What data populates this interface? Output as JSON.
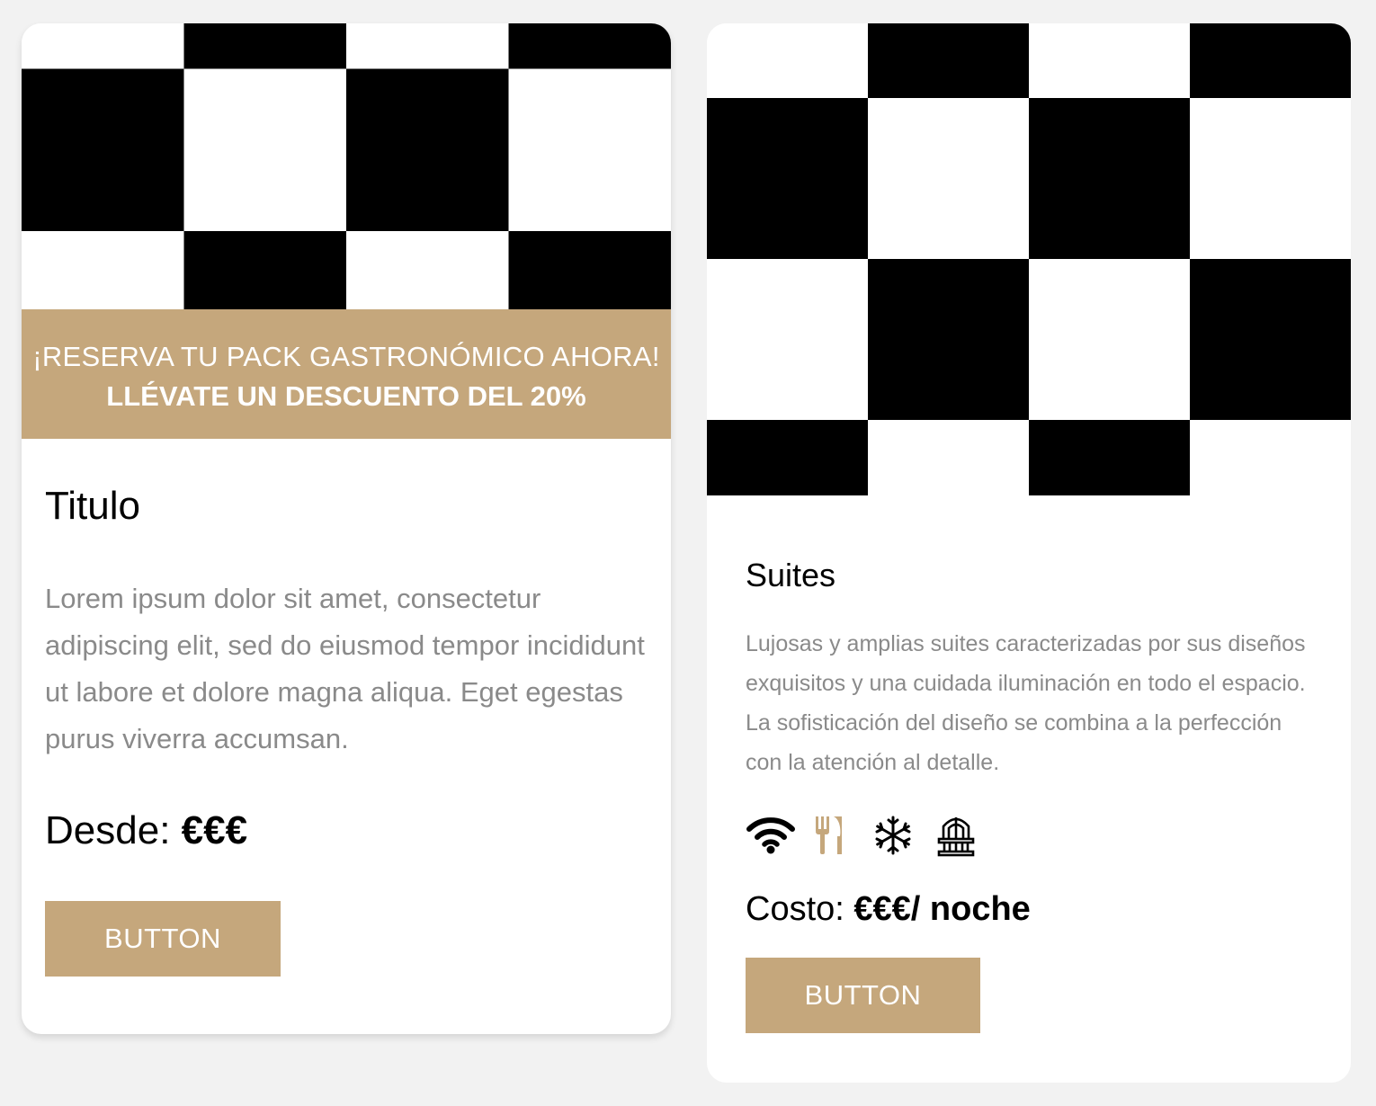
{
  "cards": [
    {
      "banner": {
        "line1": "¡RESERVA TU PACK GASTRONÓMICO AHORA!",
        "line2": "LLÉVATE UN DESCUENTO DEL 20%"
      },
      "title": "Titulo",
      "description": "Lorem ipsum dolor sit amet, consectetur adipiscing elit, sed do eiusmod tempor incididunt ut labore et dolore magna aliqua. Eget egestas purus viverra accumsan.",
      "price_label": "Desde:",
      "price_value": "€€€",
      "button_label": "BUTTON"
    },
    {
      "title": "Suites",
      "description": "Lujosas y amplias suites caracterizadas por sus diseños exquisitos y una cuidada iluminación en todo el espacio. La sofisticación del diseño se combina a la perfección con la atención al detalle.",
      "amenities": [
        {
          "icon": "wifi-icon",
          "color": "#000000"
        },
        {
          "icon": "restaurant-icon",
          "color": "#c5a77c"
        },
        {
          "icon": "air-conditioning-icon",
          "color": "#000000"
        },
        {
          "icon": "balcony-icon",
          "color": "#000000"
        }
      ],
      "price_label": "Costo:",
      "price_value": "€€€/ noche",
      "button_label": "BUTTON"
    }
  ],
  "colors": {
    "accent": "#c5a77c",
    "background": "#f2f2f2",
    "card": "#ffffff",
    "muted_text": "#8a8a8a"
  }
}
